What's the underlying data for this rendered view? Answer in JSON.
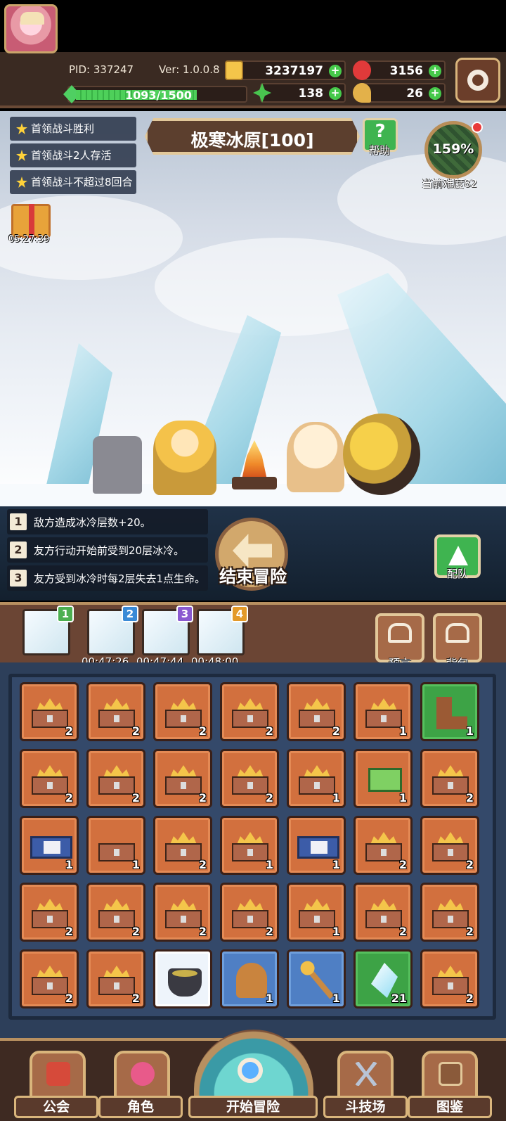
{
  "header": {
    "pid": "PID: 337247",
    "version": "Ver: 1.0.0.8",
    "gold": "3237197",
    "gems": "3156",
    "clover": "138",
    "drumstick": "26",
    "xp_text": "1093/1500",
    "xp_progress": 0.73,
    "icons": [
      "avatar",
      "gold-coin-icon",
      "red-gem-icon",
      "clover-icon",
      "drumstick-icon",
      "green-crystal-icon",
      "settings-gear-icon"
    ]
  },
  "quests": [
    "首领战斗胜利",
    "首领战斗2人存活",
    "首领战斗不超过8回合"
  ],
  "stage": {
    "title": "极寒冰原[100]",
    "help_label": "帮助",
    "help_glyph": "?",
    "difficulty_pct": "159%",
    "difficulty_label": "当前难度82",
    "gift_timer": "05:27:39"
  },
  "effects": [
    {
      "num": "1",
      "text": "敌方造成冰冷层数+20。"
    },
    {
      "num": "2",
      "text": "友方行动开始前受到20层冰冷。"
    },
    {
      "num": "3",
      "text": "友方受到冰冷时每2层失去1点生命。"
    }
  ],
  "actions": {
    "end_adventure": "结束冒险",
    "team": "配队"
  },
  "slots": [
    {
      "badge": "1",
      "time": "",
      "color": "#4caf50"
    },
    {
      "badge": "2",
      "time": "00:47:26",
      "color": "#3a8ad6"
    },
    {
      "badge": "3",
      "time": "00:47:44",
      "color": "#8a5ad0"
    },
    {
      "badge": "4",
      "time": "00:48:00",
      "color": "#e39a2a"
    }
  ],
  "side_buttons": {
    "prophecy": "预言",
    "backpack": "背包"
  },
  "inventory": [
    [
      [
        "chest",
        "2"
      ],
      [
        "chest",
        "2"
      ],
      [
        "chest",
        "2"
      ],
      [
        "chest",
        "2"
      ],
      [
        "chest",
        "2"
      ],
      [
        "chest",
        "1"
      ],
      [
        "boot",
        "1"
      ]
    ],
    [
      [
        "chest",
        "2"
      ],
      [
        "chest",
        "2"
      ],
      [
        "chest",
        "2"
      ],
      [
        "chest",
        "2"
      ],
      [
        "chest",
        "1"
      ],
      [
        "gem",
        "1"
      ],
      [
        "chest",
        "2"
      ]
    ],
    [
      [
        "bluebox",
        "1"
      ],
      [
        "plainchest",
        "1"
      ],
      [
        "chest",
        "2"
      ],
      [
        "chest",
        "1"
      ],
      [
        "bluebox",
        "1"
      ],
      [
        "chest",
        "2"
      ],
      [
        "chest",
        "2"
      ]
    ],
    [
      [
        "chest",
        "2"
      ],
      [
        "chest",
        "2"
      ],
      [
        "chest",
        "2"
      ],
      [
        "chest",
        "2"
      ],
      [
        "chest",
        "1"
      ],
      [
        "chest",
        "2"
      ],
      [
        "chest",
        "2"
      ]
    ],
    [
      [
        "chest",
        "2"
      ],
      [
        "chest",
        "2"
      ],
      [
        "pot",
        ""
      ],
      [
        "helm",
        "1"
      ],
      [
        "staff",
        "1"
      ],
      [
        "crystal",
        "21"
      ],
      [
        "chest",
        "2"
      ]
    ]
  ],
  "nav": {
    "guild": "公会",
    "character": "角色",
    "start": "开始冒险",
    "arena": "斗技场",
    "codex": "图鉴"
  }
}
